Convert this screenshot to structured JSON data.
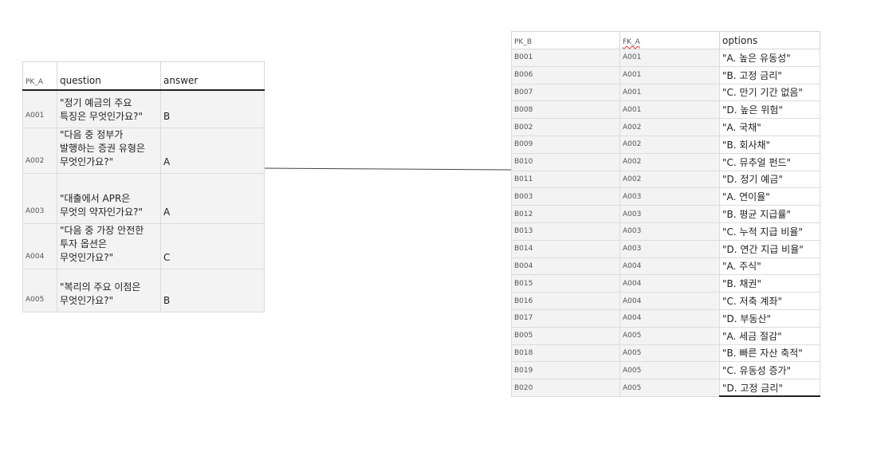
{
  "table_a": {
    "headers": {
      "pk": "PK_A",
      "question": "question",
      "answer": "answer"
    },
    "rows": [
      {
        "pk": "A001",
        "question": "\"정기 예금의 주요\n특징은 무엇인가요?\"",
        "answer": "B"
      },
      {
        "pk": "A002",
        "question": "\"다음 중 정부가\n발행하는 증권 유형은\n무엇인가요?\"",
        "answer": "A"
      },
      {
        "pk": "A003",
        "question": "\"대출에서 APR은\n무엇의 약자인가요?\"",
        "answer": "A"
      },
      {
        "pk": "A004",
        "question": "\"다음 중 가장 안전한\n투자 옵션은\n무엇인가요?\"",
        "answer": "C"
      },
      {
        "pk": "A005",
        "question": "\"복리의 주요 이점은\n무엇인가요?\"",
        "answer": "B"
      }
    ]
  },
  "table_b": {
    "headers": {
      "pk": "PK_B",
      "fk": "FK_A",
      "options": "options"
    },
    "rows": [
      {
        "pk": "B001",
        "fk": "A001",
        "option": "\"A. 높은 유동성\""
      },
      {
        "pk": "B006",
        "fk": "A001",
        "option": "\"B. 고정 금리\""
      },
      {
        "pk": "B007",
        "fk": "A001",
        "option": "\"C. 만기 기간 없음\""
      },
      {
        "pk": "B008",
        "fk": "A001",
        "option": "\"D. 높은 위험\""
      },
      {
        "pk": "B002",
        "fk": "A002",
        "option": "\"A. 국채\""
      },
      {
        "pk": "B009",
        "fk": "A002",
        "option": "\"B. 회사채\""
      },
      {
        "pk": "B010",
        "fk": "A002",
        "option": "\"C. 뮤추얼 펀드\""
      },
      {
        "pk": "B011",
        "fk": "A002",
        "option": "\"D. 정기 예금\""
      },
      {
        "pk": "B003",
        "fk": "A003",
        "option": "\"A. 연이율\""
      },
      {
        "pk": "B012",
        "fk": "A003",
        "option": "\"B. 평균 지급률\""
      },
      {
        "pk": "B013",
        "fk": "A003",
        "option": "\"C. 누적 지급 비율\""
      },
      {
        "pk": "B014",
        "fk": "A003",
        "option": "\"D. 연간 지급 비율\""
      },
      {
        "pk": "B004",
        "fk": "A004",
        "option": "\"A. 주식\""
      },
      {
        "pk": "B015",
        "fk": "A004",
        "option": "\"B. 채권\""
      },
      {
        "pk": "B016",
        "fk": "A004",
        "option": "\"C. 저축 계좌\""
      },
      {
        "pk": "B017",
        "fk": "A004",
        "option": "\"D. 부동산\""
      },
      {
        "pk": "B005",
        "fk": "A005",
        "option": "\"A. 세금 절감\""
      },
      {
        "pk": "B018",
        "fk": "A005",
        "option": "\"B. 빠른 자산 축적\""
      },
      {
        "pk": "B019",
        "fk": "A005",
        "option": "\"C. 유동성 증가\""
      },
      {
        "pk": "B020",
        "fk": "A005",
        "option": "\"D. 고정 금리\""
      }
    ]
  },
  "colors": {
    "cell_bg": "#f3f3f3",
    "border": "#dcdcdc",
    "header_rule": "#222222",
    "connector": "#444444",
    "spell_underline": "#dd3333"
  }
}
